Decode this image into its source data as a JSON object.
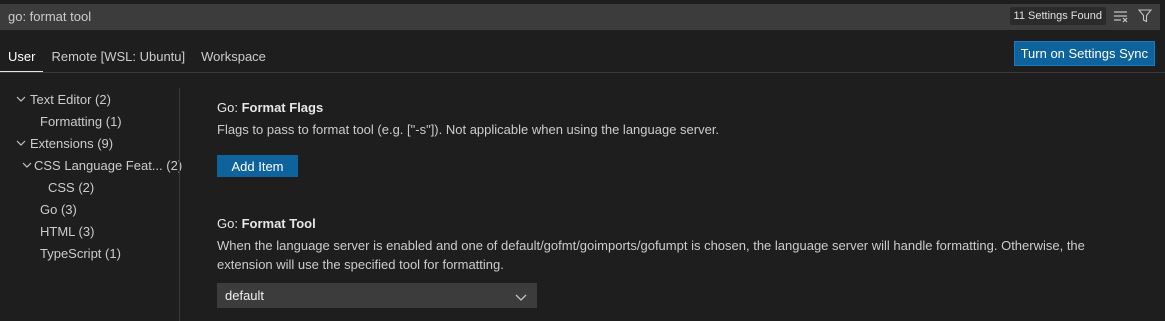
{
  "search": {
    "value": "go: format tool",
    "found": "11 Settings Found",
    "clear_icon": "clear-filter-icon",
    "filter_icon": "filter-icon"
  },
  "tabs": [
    {
      "label": "User",
      "active": true
    },
    {
      "label": "Remote [WSL: Ubuntu]",
      "active": false
    },
    {
      "label": "Workspace",
      "active": false
    }
  ],
  "sync_button": "Turn on Settings Sync",
  "toc": [
    {
      "label": "Text Editor (2)",
      "expanded": true
    },
    {
      "label": "Formatting (1)"
    },
    {
      "label": "Extensions (9)",
      "expanded": true
    },
    {
      "label": "CSS Language Feat... (2)",
      "expanded": true
    },
    {
      "label": "CSS (2)"
    },
    {
      "label": "Go (3)"
    },
    {
      "label": "HTML (3)"
    },
    {
      "label": "TypeScript (1)"
    }
  ],
  "settings": {
    "format_flags": {
      "category": "Go: ",
      "key": "Format Flags",
      "description": "Flags to pass to format tool (e.g. [\"-s\"]). Not applicable when using the language server.",
      "button": "Add Item"
    },
    "format_tool": {
      "category": "Go: ",
      "key": "Format Tool",
      "description_line1": "When the language server is enabled and one of default/gofmt/goimports/gofumpt is chosen, the language server will handle formatting. Otherwise, the",
      "description_line2": "extension will use the specified tool for formatting.",
      "selected": "default"
    }
  },
  "colors": {
    "background": "#1e1e1e",
    "accent_button": "#0e639c",
    "input_bg": "#3c3c3c"
  }
}
